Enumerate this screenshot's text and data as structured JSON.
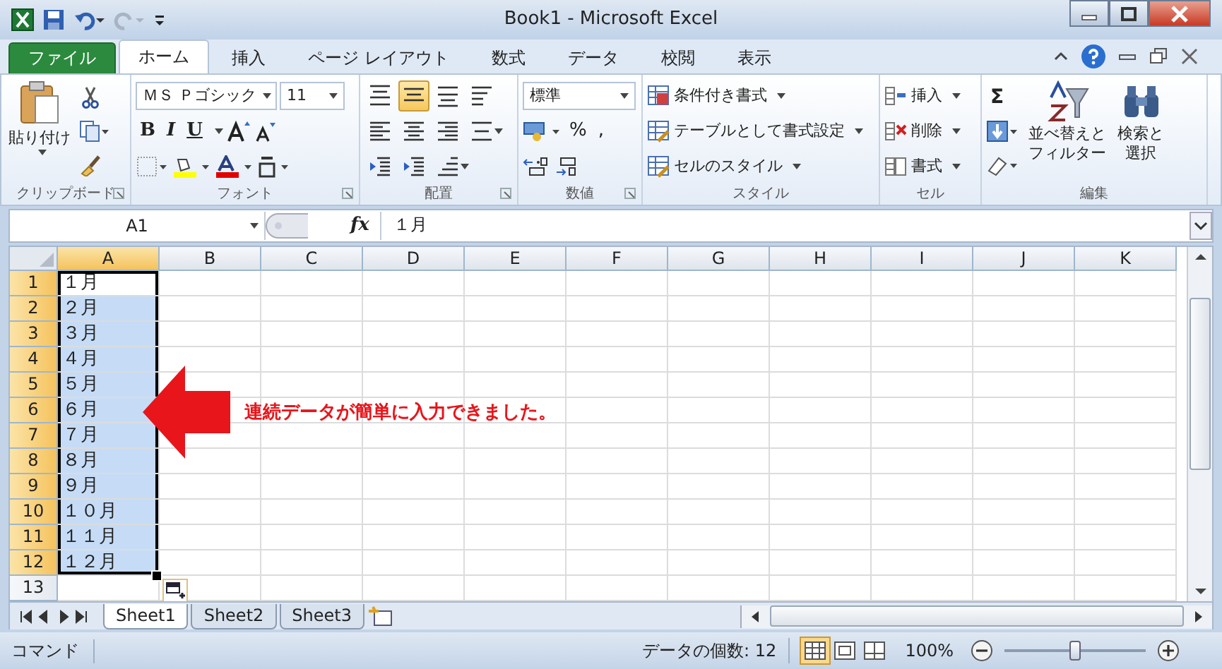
{
  "window": {
    "title": "Book1 - Microsoft Excel"
  },
  "tabs": [
    {
      "label": "ファイル",
      "kind": "file",
      "selected": false
    },
    {
      "label": "ホーム",
      "kind": "tab",
      "selected": true
    },
    {
      "label": "挿入",
      "kind": "tab",
      "selected": false
    },
    {
      "label": "ページ レイアウト",
      "kind": "tab",
      "selected": false
    },
    {
      "label": "数式",
      "kind": "tab",
      "selected": false
    },
    {
      "label": "データ",
      "kind": "tab",
      "selected": false
    },
    {
      "label": "校閲",
      "kind": "tab",
      "selected": false
    },
    {
      "label": "表示",
      "kind": "tab",
      "selected": false
    }
  ],
  "ribbon": {
    "clipboard": {
      "paste": "貼り付け",
      "label": "クリップボード"
    },
    "font": {
      "font_name": "ＭＳ Ｐゴシック",
      "font_size": "11",
      "style_buttons": [
        "B",
        "I",
        "U"
      ],
      "label": "フォント"
    },
    "alignment": {
      "label": "配置",
      "rows": [
        [
          {
            "kind": "top",
            "selected": false,
            "dropdown": false
          },
          {
            "kind": "middle",
            "selected": true,
            "dropdown": false
          },
          {
            "kind": "bottom",
            "selected": false,
            "dropdown": false
          },
          {
            "kind": "wrap",
            "selected": false,
            "dropdown": false
          }
        ],
        [
          {
            "kind": "left",
            "selected": false,
            "dropdown": false
          },
          {
            "kind": "center",
            "selected": false,
            "dropdown": false
          },
          {
            "kind": "right",
            "selected": false,
            "dropdown": false
          },
          {
            "kind": "merge",
            "selected": false,
            "dropdown": true
          }
        ],
        [
          {
            "kind": "outdent",
            "selected": false,
            "dropdown": false
          },
          {
            "kind": "indent",
            "selected": false,
            "dropdown": false
          },
          {
            "kind": "orientation",
            "selected": false,
            "dropdown": true
          }
        ]
      ]
    },
    "number": {
      "format": "標準",
      "symbols": [
        "%",
        ","
      ],
      "label": "数値"
    },
    "styles": {
      "items": [
        "条件付き書式",
        "テーブルとして書式設定",
        "セルのスタイル"
      ],
      "label": "スタイル"
    },
    "cells": {
      "items": [
        "挿入",
        "削除",
        "書式"
      ],
      "label": "セル"
    },
    "editing": {
      "autosum": "Σ",
      "sort": [
        "並べ替えと",
        "フィルター"
      ],
      "find": [
        "検索と",
        "選択"
      ],
      "label": "編集"
    }
  },
  "formula_bar": {
    "name_box": "A1",
    "fx": "fx",
    "value": "１月"
  },
  "columns": [
    {
      "label": "A",
      "selected": true
    },
    {
      "label": "B",
      "selected": false
    },
    {
      "label": "C",
      "selected": false
    },
    {
      "label": "D",
      "selected": false
    },
    {
      "label": "E",
      "selected": false
    },
    {
      "label": "F",
      "selected": false
    },
    {
      "label": "G",
      "selected": false
    },
    {
      "label": "H",
      "selected": false
    },
    {
      "label": "I",
      "selected": false
    },
    {
      "label": "J",
      "selected": false
    },
    {
      "label": "K",
      "selected": false
    }
  ],
  "rows": [
    {
      "header": "1",
      "selected": true,
      "active": true,
      "cells": [
        "１月"
      ]
    },
    {
      "header": "2",
      "selected": true,
      "active": false,
      "cells": [
        "２月"
      ]
    },
    {
      "header": "3",
      "selected": true,
      "active": false,
      "cells": [
        "３月"
      ]
    },
    {
      "header": "4",
      "selected": true,
      "active": false,
      "cells": [
        "４月"
      ]
    },
    {
      "header": "5",
      "selected": true,
      "active": false,
      "cells": [
        "５月"
      ]
    },
    {
      "header": "6",
      "selected": true,
      "active": false,
      "cells": [
        "６月"
      ]
    },
    {
      "header": "7",
      "selected": true,
      "active": false,
      "cells": [
        "７月"
      ]
    },
    {
      "header": "8",
      "selected": true,
      "active": false,
      "cells": [
        "８月"
      ]
    },
    {
      "header": "9",
      "selected": true,
      "active": false,
      "cells": [
        "９月"
      ]
    },
    {
      "header": "10",
      "selected": true,
      "active": false,
      "cells": [
        "１０月"
      ]
    },
    {
      "header": "11",
      "selected": true,
      "active": false,
      "cells": [
        "１１月"
      ]
    },
    {
      "header": "12",
      "selected": true,
      "active": false,
      "cells": [
        "１２月"
      ]
    },
    {
      "header": "13",
      "selected": false,
      "active": false,
      "cells": []
    }
  ],
  "annotation": "連続データが簡単に入力できました。",
  "sheet_tabs": [
    {
      "label": "Sheet1",
      "selected": true
    },
    {
      "label": "Sheet2",
      "selected": false
    },
    {
      "label": "Sheet3",
      "selected": false
    }
  ],
  "status_bar": {
    "mode": "コマンド",
    "count": "データの個数: 12",
    "zoom": "100%",
    "zoom_slider": {
      "level": 0.5
    }
  }
}
